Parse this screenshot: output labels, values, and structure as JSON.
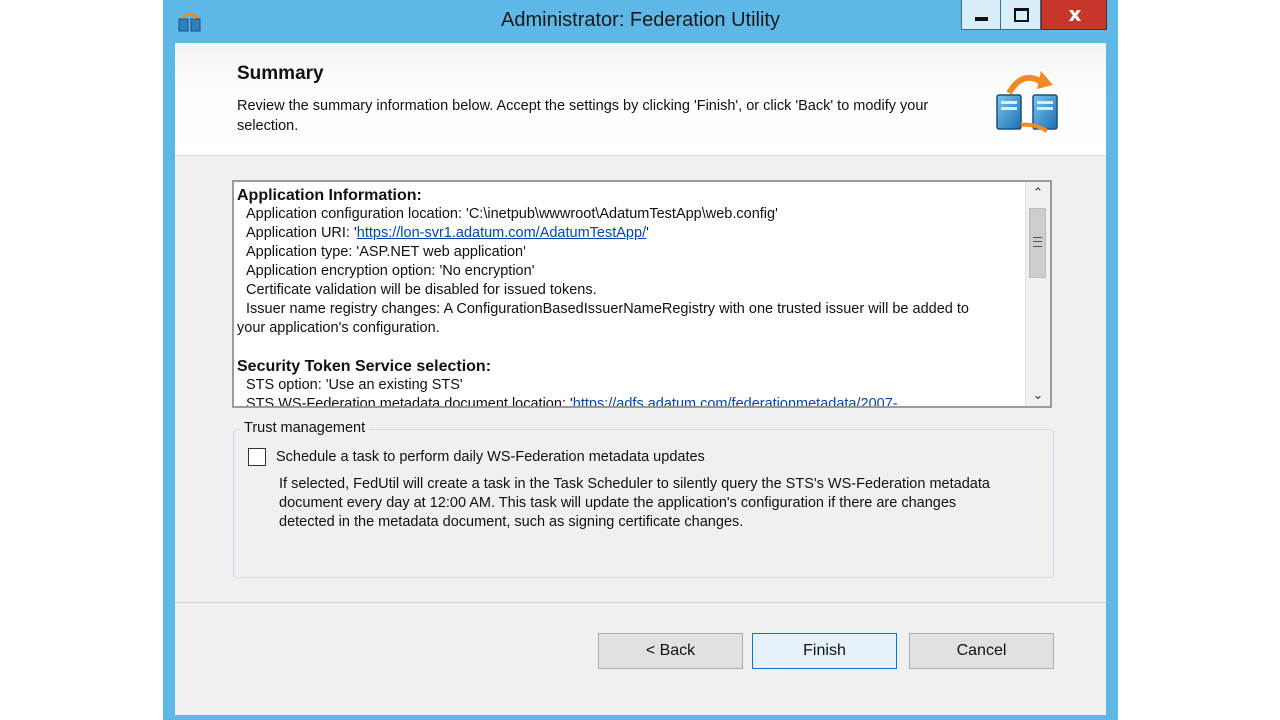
{
  "window": {
    "title": "Administrator: Federation Utility",
    "close_glyph": "x"
  },
  "header": {
    "title": "Summary",
    "description": "Review the summary information below. Accept the settings by clicking 'Finish', or click 'Back' to modify your selection."
  },
  "summary": {
    "app_section": "Application Information:",
    "app_config_location": "Application configuration location: 'C:\\inetpub\\wwwroot\\AdatumTestApp\\web.config'",
    "app_uri_label": "Application URI: '",
    "app_uri_link": "https://lon-svr1.adatum.com/AdatumTestApp/",
    "app_uri_suffix": "'",
    "app_type": "Application type: 'ASP.NET web application'",
    "app_encryption": "Application encryption option: 'No encryption'",
    "cert_validation": "Certificate validation will be disabled for issued tokens.",
    "issuer_registry_line1": "Issuer name registry changes: A ConfigurationBasedIssuerNameRegistry with one trusted issuer will be added to",
    "issuer_registry_line2": "your application's configuration.",
    "sts_section": "Security Token Service selection:",
    "sts_option": "STS option: 'Use an existing STS'",
    "sts_metadata_label": "STS WS-Federation metadata document location: '",
    "sts_metadata_link": "https://adfs.adatum.com/federationmetadata/2007-"
  },
  "trust": {
    "group_title": "Trust management",
    "checkbox_label": "Schedule a task to perform daily WS-Federation metadata updates",
    "checkbox_checked": false,
    "description": "If selected, FedUtil will create a task in the Task Scheduler to silently query the STS's WS-Federation metadata document every day at 12:00 AM.  This task will update the application's configuration if there are changes detected in the metadata document, such as signing certificate changes."
  },
  "buttons": {
    "back": "< Back",
    "finish": "Finish",
    "cancel": "Cancel"
  },
  "colors": {
    "title_bar": "#5db8e8",
    "close_button": "#c7362a",
    "link": "#0645ad",
    "default_button_border": "#0078d7"
  }
}
